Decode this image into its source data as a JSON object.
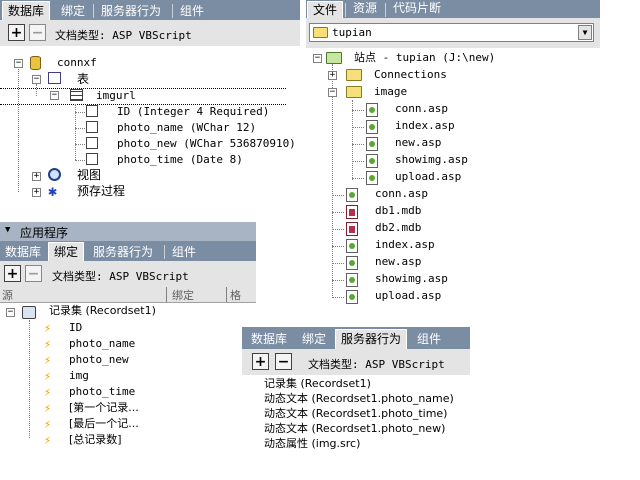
{
  "panel_db": {
    "tabs": [
      "数据库",
      "绑定",
      "服务器行为",
      "组件"
    ],
    "doctype": "文档类型: ASP VBScript",
    "tree": {
      "connection": "connxf",
      "tables_label": "表",
      "table": "imgurl",
      "columns": [
        "ID (Integer 4 Required)",
        "photo_name (WChar 12)",
        "photo_new (WChar 536870910)",
        "photo_time (Date 8)"
      ],
      "views_label": "视图",
      "procs_label": "预存过程"
    }
  },
  "panel_files": {
    "tabs": [
      "文件",
      "资源",
      "代码片断"
    ],
    "site_select": "tupian",
    "root_label": "站点 - tupian (J:\\new)",
    "folders": [
      "Connections",
      "image"
    ],
    "image_files": [
      "conn.asp",
      "index.asp",
      "new.asp",
      "showimg.asp",
      "upload.asp"
    ],
    "root_files": [
      "conn.asp",
      "db1.mdb",
      "db2.mdb",
      "index.asp",
      "new.asp",
      "showimg.asp",
      "upload.asp"
    ]
  },
  "panel_app": {
    "title": "应用程序",
    "tabs": [
      "数据库",
      "绑定",
      "服务器行为",
      "组件"
    ],
    "doctype": "文档类型: ASP VBScript",
    "col_source": "源",
    "col_binding": "绑定",
    "col_format": "格",
    "recordset": "记录集 (Recordset1)",
    "fields": [
      "ID",
      "photo_name",
      "photo_new",
      "img",
      "photo_time",
      "[第一个记录...",
      "[最后一个记...",
      "[总记录数]"
    ]
  },
  "panel_sb": {
    "tabs": [
      "数据库",
      "绑定",
      "服务器行为",
      "组件"
    ],
    "doctype": "文档类型: ASP VBScript",
    "items": [
      "记录集 (Recordset1)",
      "动态文本 (Recordset1.photo_name)",
      "动态文本 (Recordset1.photo_time)",
      "动态文本 (Recordset1.photo_new)",
      "动态属性 (img.src)"
    ]
  }
}
